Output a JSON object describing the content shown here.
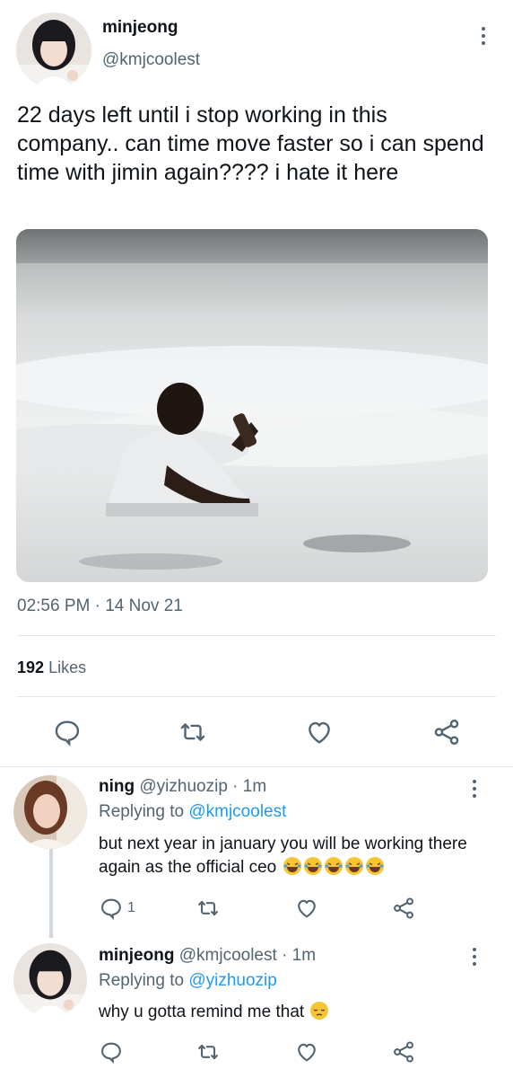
{
  "tweet": {
    "display_name": "minjeong",
    "handle": "@kmjcoolest",
    "text": "22 days left until i stop working in this company.. can time move faster so i can spend time with jimin again???? i hate it here",
    "time": "02:56 PM",
    "sep": "·",
    "date": "14 Nov 21",
    "likes_count": "192",
    "likes_label": "Likes"
  },
  "replies": [
    {
      "display_name": "ning",
      "handle": "@yizhuozip",
      "sep": "·",
      "time": "1m",
      "replying_label": "Replying to",
      "replying_to": "@kmjcoolest",
      "text": "but next year in january you will be working there again as the official ceo",
      "emoji": "😂😂😂😂😂",
      "reply_count": "1"
    },
    {
      "display_name": "minjeong",
      "handle": "@kmjcoolest",
      "sep": "·",
      "time": "1m",
      "replying_label": "Replying to",
      "replying_to": "@yizhuozip",
      "text": "why u gotta remind me that",
      "emoji": "😔"
    }
  ],
  "colors": {
    "text": "#0f1419",
    "muted": "#536471",
    "accent": "#1d9bf0",
    "divider": "#e4e7ea"
  }
}
